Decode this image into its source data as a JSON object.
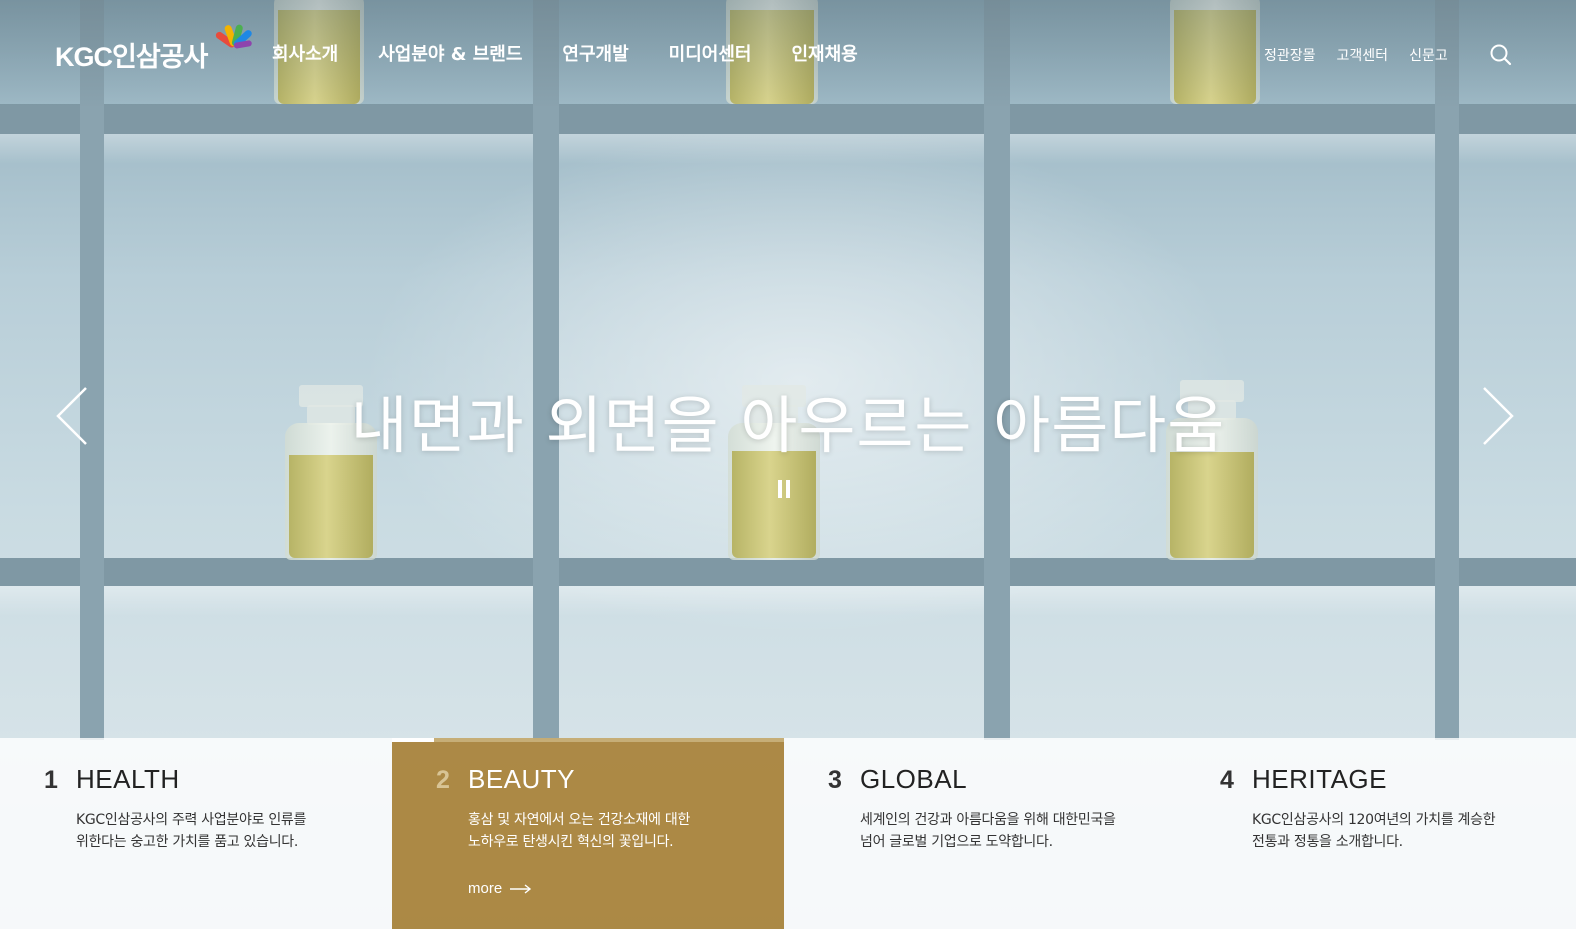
{
  "brand": {
    "logo_text": "KGC인삼공사"
  },
  "nav": {
    "items": [
      {
        "label": "회사소개"
      },
      {
        "label": "사업분야 & 브랜드"
      },
      {
        "label": "연구개발"
      },
      {
        "label": "미디어센터"
      },
      {
        "label": "인재채용"
      }
    ]
  },
  "utility": {
    "items": [
      {
        "label": "정관장몰"
      },
      {
        "label": "고객센터"
      },
      {
        "label": "신문고"
      }
    ]
  },
  "hero": {
    "headline": "내면과 외면을 아우르는 아름다움"
  },
  "panels": [
    {
      "num": "1",
      "title": "HEALTH",
      "desc": "KGC인삼공사의 주력 사업분야로 인류를\n위한다는 숭고한 가치를 품고 있습니다.",
      "active": false
    },
    {
      "num": "2",
      "title": "BEAUTY",
      "desc": "홍삼 및 자연에서 오는 건강소재에 대한\n노하우로 탄생시킨 혁신의 꽃입니다.",
      "active": true,
      "more": "more"
    },
    {
      "num": "3",
      "title": "GLOBAL",
      "desc": "세계인의 건강과 아름다움을 위해 대한민국을\n넘어 글로벌 기업으로 도약합니다.",
      "active": false
    },
    {
      "num": "4",
      "title": "HERITAGE",
      "desc": "KGC인삼공사의 120여년의 가치를 계승한\n전통과 정통을 소개합니다.",
      "active": false
    }
  ],
  "colors": {
    "active_panel": "#a88137",
    "panel_bg": "#ffffff",
    "text_white": "#ffffff"
  },
  "icons": {
    "search": "search-icon",
    "prev": "chevron-left-icon",
    "next": "chevron-right-icon",
    "pause": "pause-icon",
    "more": "arrow-right-icon"
  }
}
